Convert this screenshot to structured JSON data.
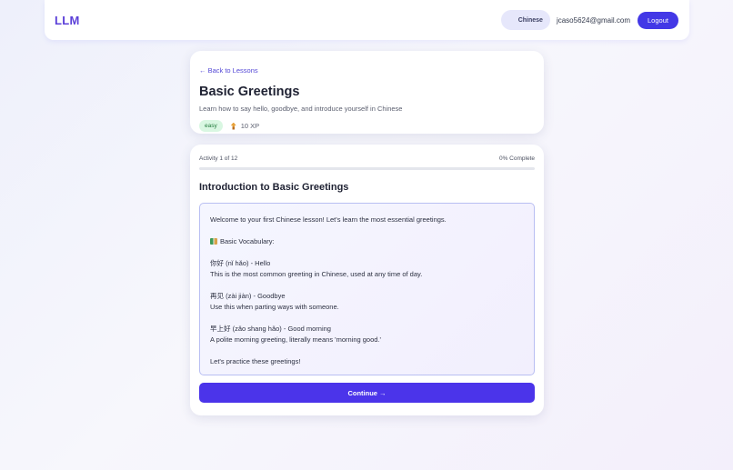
{
  "header": {
    "brand": "LLM",
    "language": "Chinese",
    "email": "jcaso5624@gmail.com",
    "logout_label": "Logout"
  },
  "lesson": {
    "back_label": "← Back to Lessons",
    "title": "Basic Greetings",
    "description": "Learn how to say hello, goodbye, and introduce yourself in Chinese",
    "difficulty": "easy",
    "xp": "10 XP"
  },
  "activity": {
    "counter": "Activity 1 of 12",
    "complete": "0% Complete",
    "progress_fraction": 0,
    "title": "Introduction to Basic Greetings",
    "lines": [
      "Welcome to your first Chinese lesson! Let's learn the most essential greetings.",
      "",
      "Basic Vocabulary:",
      "",
      "你好 (nǐ hǎo) - Hello",
      "This is the most common greeting in Chinese, used at any time of day.",
      "",
      "再见 (zài jiàn) - Goodbye",
      "Use this when parting ways with someone.",
      "",
      "早上好 (zǎo shang hǎo) - Good morning",
      "A polite morning greeting, literally means 'morning good.'",
      "",
      "Let's practice these greetings!"
    ],
    "continue_label": "Continue →"
  },
  "colors": {
    "accent": "#4338e6",
    "brand": "#5b3fd8",
    "easy_badge_bg": "#d9f7e2",
    "easy_badge_text": "#217a3b"
  },
  "icons": {
    "xp": "hourglass-icon",
    "vocabulary": "books-icon"
  }
}
